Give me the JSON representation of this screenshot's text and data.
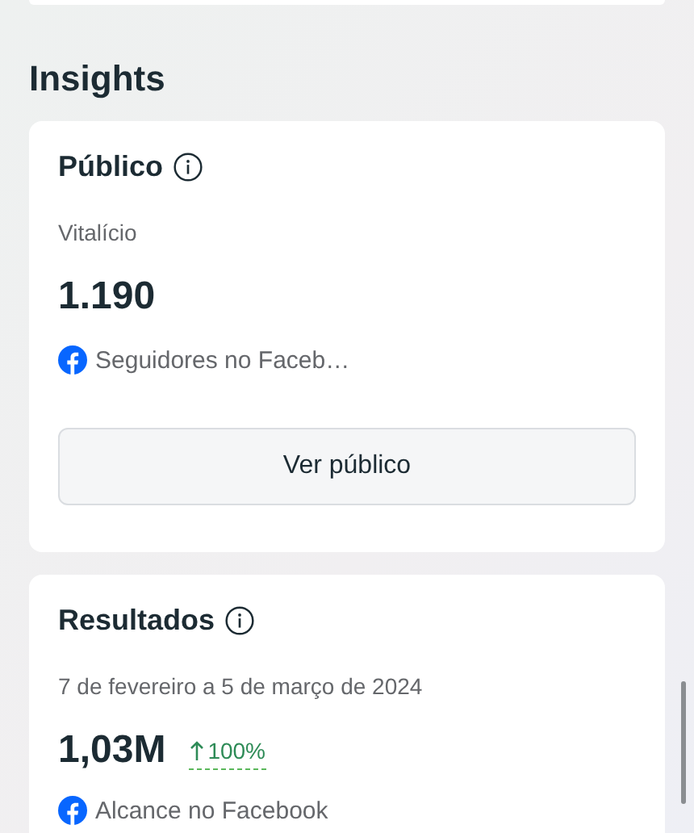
{
  "section_title": "Insights",
  "cards": [
    {
      "title": "Público",
      "period": "Vitalício",
      "value": "1.190",
      "source": "Seguidores no Faceb…",
      "button": "Ver público"
    },
    {
      "title": "Resultados",
      "period": "7 de fevereiro a 5 de março de 2024",
      "value": "1,03M",
      "trend": "100%",
      "source": "Alcance no Facebook"
    }
  ]
}
